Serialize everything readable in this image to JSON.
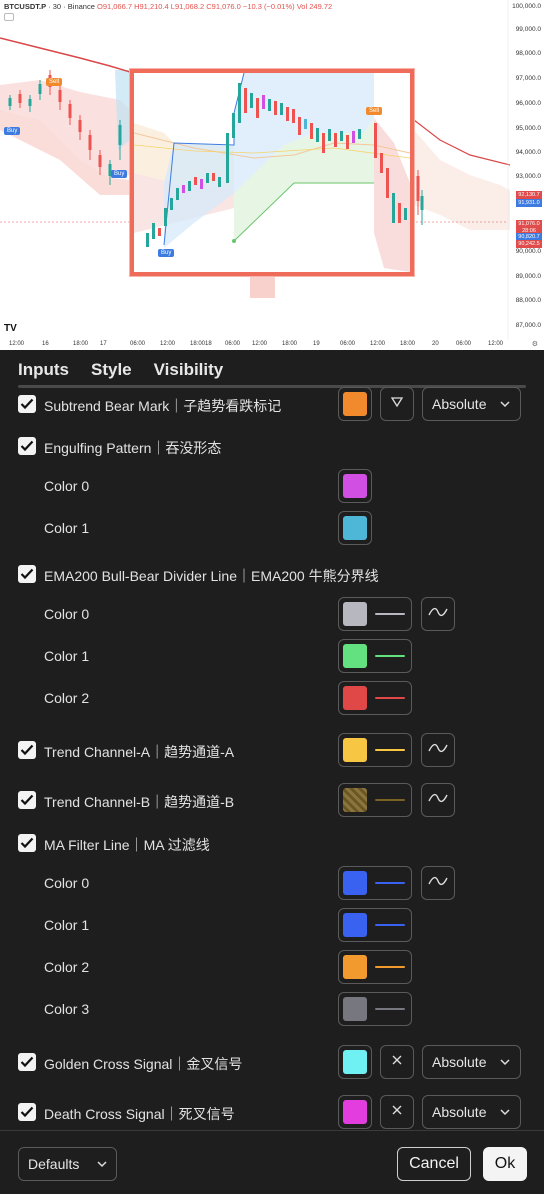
{
  "chart": {
    "symbol": "BTCUSDT.P",
    "interval": "30",
    "exchange": "Binance",
    "ohlc_text": "O91,066.7  H91,210.4  L91,068.2  C91,076.0  −10.3 (−0.01%)  Vol 249.72",
    "y_labels": [
      "100,000.0",
      "99,000.0",
      "98,000.0",
      "97,000.0",
      "96,000.0",
      "95,000.0",
      "94,000.0",
      "93,000.0",
      "92,000.0",
      "91,000.0",
      "90,000.0",
      "89,000.0",
      "88,000.0",
      "87,000.0"
    ],
    "x_labels": [
      "12:00",
      "16",
      "18:00",
      "17",
      "06:00",
      "12:00",
      "18:00",
      "18",
      "06:00",
      "12:00",
      "18:00",
      "19",
      "06:00",
      "12:00",
      "18:00",
      "20",
      "06:00",
      "12:00"
    ],
    "price_tags": [
      {
        "text": "92,130.7",
        "color": "#e04b4b"
      },
      {
        "text": "91,931.0",
        "color": "#3d7be0"
      },
      {
        "text": "91,076.0",
        "color": "#e04b4b"
      },
      {
        "text": "28:06",
        "color": "#e04b4b"
      },
      {
        "text": "90,820.7",
        "color": "#3d7be0"
      },
      {
        "text": "90,242.5",
        "color": "#e04b4b"
      }
    ],
    "signals": {
      "buy": "Buy",
      "sell": "Sell"
    },
    "logo": "TV"
  },
  "tabs": [
    {
      "label": "Inputs",
      "active": false
    },
    {
      "label": "Style",
      "active": true
    },
    {
      "label": "Visibility",
      "active": false
    }
  ],
  "rows": {
    "subtrend_bear": {
      "label": "Subtrend Bear Mark｜子趋势看跌标记",
      "checked": true,
      "color": "#f08a2c",
      "shape_icon": "triangle-down-icon",
      "select": "Absolute"
    },
    "engulfing": {
      "label": "Engulfing Pattern｜吞没形态",
      "checked": true
    },
    "engulfing_c0": {
      "label": "Color 0",
      "color": "#d24fe3"
    },
    "engulfing_c1": {
      "label": "Color 1",
      "color": "#4eb6d6"
    },
    "ema200": {
      "label": "EMA200 Bull-Bear Divider Line｜EMA200 牛熊分界线",
      "checked": true
    },
    "ema200_c0": {
      "label": "Color 0",
      "color": "#b7b7c0"
    },
    "ema200_c1": {
      "label": "Color 1",
      "color": "#63e07f"
    },
    "ema200_c2": {
      "label": "Color 2",
      "color": "#e04848"
    },
    "trend_a": {
      "label": "Trend Channel-A｜趋势通道-A",
      "checked": true,
      "color": "#f7c744"
    },
    "trend_b": {
      "label": "Trend Channel-B｜趋势通道-B",
      "checked": true,
      "color": "#7a6124"
    },
    "ma_filter": {
      "label": "MA Filter Line｜MA 过滤线",
      "checked": true
    },
    "ma_c0": {
      "label": "Color 0",
      "color": "#3a62f0"
    },
    "ma_c1": {
      "label": "Color 1",
      "color": "#3a62f0"
    },
    "ma_c2": {
      "label": "Color 2",
      "color": "#f29a2e"
    },
    "ma_c3": {
      "label": "Color 3",
      "color": "#77777f"
    },
    "golden_cross": {
      "label": "Golden Cross Signal｜金叉信号",
      "checked": true,
      "color": "#6ff1f4",
      "shape_icon": "x-cross-icon",
      "select": "Absolute"
    },
    "death_cross": {
      "label": "Death Cross Signal｜死叉信号",
      "checked": true,
      "color": "#e33de0",
      "shape_icon": "x-cross-icon",
      "select": "Absolute"
    }
  },
  "footer": {
    "defaults": "Defaults",
    "cancel": "Cancel",
    "ok": "Ok"
  }
}
